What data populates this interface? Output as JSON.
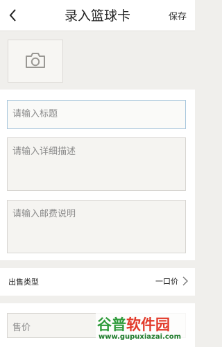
{
  "header": {
    "title": "录入篮球卡",
    "save_label": "保存"
  },
  "form": {
    "title_placeholder": "请输入标题",
    "detail_placeholder": "请输入详细描述",
    "postage_placeholder": "请输入邮费说明"
  },
  "sale_type": {
    "label": "出售类型",
    "value": "一口价"
  },
  "price": {
    "placeholder": "售价"
  },
  "watermark": {
    "title": "谷普软件园",
    "url": "www.gupuxiazai.com"
  },
  "colors": {
    "background": "#f0efec",
    "watermark_green": "#2e9b3a",
    "watermark_red": "#e23a2a"
  },
  "icons": {
    "back": "chevron-left-icon",
    "photo": "camera-icon",
    "more": "chevron-right-icon"
  }
}
